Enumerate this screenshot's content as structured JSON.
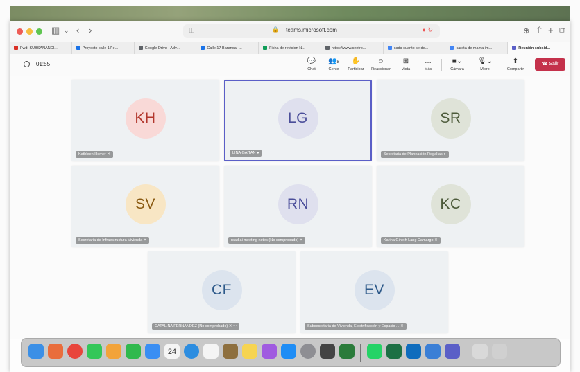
{
  "browser": {
    "url": "teams.microsoft.com",
    "tabs": [
      {
        "label": "Fwd: SUBSANANCI...",
        "color": "#d93025"
      },
      {
        "label": "Proyecto calle 17 e...",
        "color": "#1a73e8"
      },
      {
        "label": "Google Drive - Adv...",
        "color": "#5f6368"
      },
      {
        "label": "Calle 17 Baranoa -...",
        "color": "#1a73e8"
      },
      {
        "label": "Ficha de revision N...",
        "color": "#0f9d58"
      },
      {
        "label": "https://www.centro...",
        "color": "#5f6368"
      },
      {
        "label": "cada cuanto se de...",
        "color": "#4285f4"
      },
      {
        "label": "careta de mama im...",
        "color": "#4285f4"
      },
      {
        "label": "Reunión subsid...",
        "color": "#5b5fc7"
      }
    ]
  },
  "meeting": {
    "timer": "01:55",
    "controls": {
      "chat": "Chat",
      "people": "Gente",
      "people_count": "8",
      "raise": "Participar",
      "react": "Reaccionar",
      "view": "Vista",
      "more": "Más",
      "camera": "Cámara",
      "mic": "Micro",
      "share": "Compartir",
      "leave": "Salir"
    },
    "participants": [
      {
        "initials": "KH",
        "name": "Kathleen Hemer",
        "bg": "#f9d9d7",
        "fg": "#b2362c"
      },
      {
        "initials": "LG",
        "name": "LINA GAITAN",
        "bg": "#dfe0ee",
        "fg": "#4b4e9a"
      },
      {
        "initials": "SR",
        "name": "Secretaria de Planeación Regalías",
        "bg": "#dfe3d8",
        "fg": "#4d5b3b"
      },
      {
        "initials": "SV",
        "name": "Secretaria de Infraestructura Vivienda",
        "bg": "#f8e6c4",
        "fg": "#8a5a12"
      },
      {
        "initials": "RN",
        "name": "read.ai meeting notes (No comprobado)",
        "bg": "#dfe0ee",
        "fg": "#4b4e9a"
      },
      {
        "initials": "KC",
        "name": "Karina Gineth Lang Camargo",
        "bg": "#dfe3d8",
        "fg": "#4d5b3b"
      },
      {
        "initials": "CF",
        "name": "CATALINA FERNANDEZ (No comprobado)",
        "bg": "#dce4ee",
        "fg": "#2e5a8a"
      },
      {
        "initials": "EV",
        "name": "Subsecretaria de Vivienda, Electrificación y Espacio ...",
        "bg": "#dce4ee",
        "fg": "#2e5a8a"
      }
    ]
  },
  "dock": {
    "calendar_day": "24",
    "apps": [
      {
        "name": "finder-icon",
        "color": "#3b8fe6"
      },
      {
        "name": "launchpad-icon",
        "color": "#e96d3c"
      },
      {
        "name": "chrome-icon",
        "color": "#e8453c"
      },
      {
        "name": "messages-icon",
        "color": "#34c759"
      },
      {
        "name": "photos-icon",
        "color": "#f2a33a"
      },
      {
        "name": "facetime-icon",
        "color": "#30b94d"
      },
      {
        "name": "mail-icon",
        "color": "#3a8ef3"
      },
      {
        "name": "calendar-icon",
        "color": "#f5f5f5"
      },
      {
        "name": "safari-icon",
        "color": "#2d8de0"
      },
      {
        "name": "reminders-icon",
        "color": "#f4f4f4"
      },
      {
        "name": "notes-app-icon",
        "color": "#8e6f3e"
      },
      {
        "name": "stickies-icon",
        "color": "#f6d451"
      },
      {
        "name": "podcasts-icon",
        "color": "#a05be0"
      },
      {
        "name": "appstore-icon",
        "color": "#1f8df5"
      },
      {
        "name": "settings-icon",
        "color": "#8e8e93"
      },
      {
        "name": "books-icon",
        "color": "#444444"
      },
      {
        "name": "hdi-icon",
        "color": "#2a7b3a"
      },
      {
        "name": "whatsapp-icon",
        "color": "#25d366"
      },
      {
        "name": "excel-icon",
        "color": "#1d7044"
      },
      {
        "name": "outlook-icon",
        "color": "#0f6cbd"
      },
      {
        "name": "preview-icon",
        "color": "#3b7fd6"
      },
      {
        "name": "teams-icon",
        "color": "#5b5fc7"
      },
      {
        "name": "downloads-icon",
        "color": "#d9d9d9"
      },
      {
        "name": "trash-icon",
        "color": "#d0d0d0"
      }
    ]
  }
}
